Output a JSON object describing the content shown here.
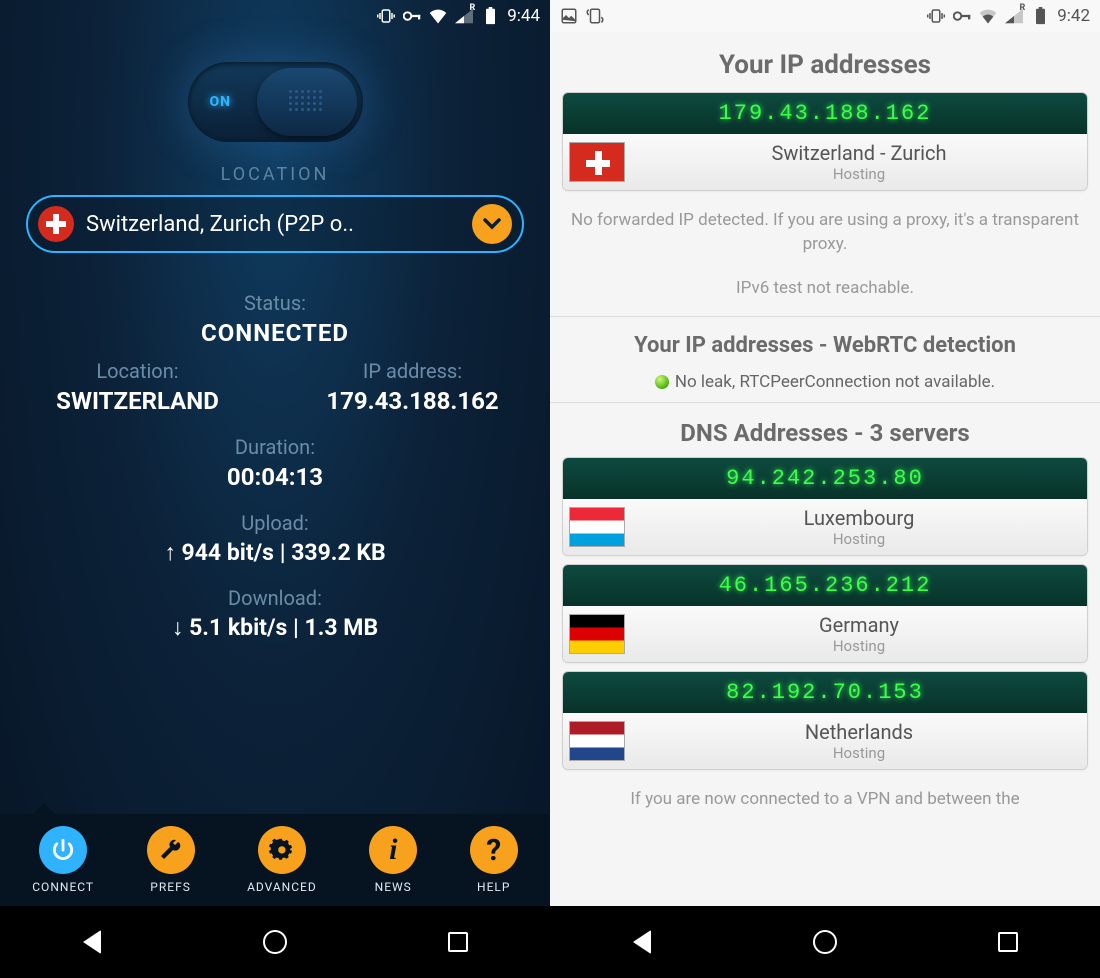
{
  "left": {
    "status_bar": {
      "time": "9:44",
      "roam_badge": "R"
    },
    "toggle": {
      "on_label": "ON"
    },
    "location_heading": "LOCATION",
    "location_value": "Switzerland, Zurich (P2P o..",
    "status_label": "Status:",
    "status_value": "CONNECTED",
    "loc_label": "Location:",
    "loc_value": "SWITZERLAND",
    "ip_label": "IP address:",
    "ip_value": "179.43.188.162",
    "dur_label": "Duration:",
    "dur_value": "00:04:13",
    "up_label": "Upload:",
    "up_value": "↑ 944 bit/s | 339.2 KB",
    "dn_label": "Download:",
    "dn_value": "↓ 5.1 kbit/s | 1.3 MB",
    "nav": {
      "connect": "CONNECT",
      "prefs": "PREFS",
      "advanced": "ADVANCED",
      "news": "NEWS",
      "help": "HELP"
    }
  },
  "right": {
    "status_bar": {
      "time": "9:42",
      "roam_badge": "R"
    },
    "h1": "Your IP addresses",
    "main_ip": {
      "ip": "179.43.188.162",
      "loc": "Switzerland - Zurich",
      "type": "Hosting"
    },
    "note1": "No forwarded IP detected. If you are using a proxy, it's a transparent proxy.",
    "note2": "IPv6 test not reachable.",
    "h2": "Your IP addresses - WebRTC detection",
    "webrtc": "No leak, RTCPeerConnection not available.",
    "h3": "DNS Addresses - 3 servers",
    "dns": [
      {
        "ip": "94.242.253.80",
        "loc": "Luxembourg",
        "type": "Hosting"
      },
      {
        "ip": "46.165.236.212",
        "loc": "Germany",
        "type": "Hosting"
      },
      {
        "ip": "82.192.70.153",
        "loc": "Netherlands",
        "type": "Hosting"
      }
    ],
    "footer_note": "If you are now connected to a VPN and between the"
  }
}
